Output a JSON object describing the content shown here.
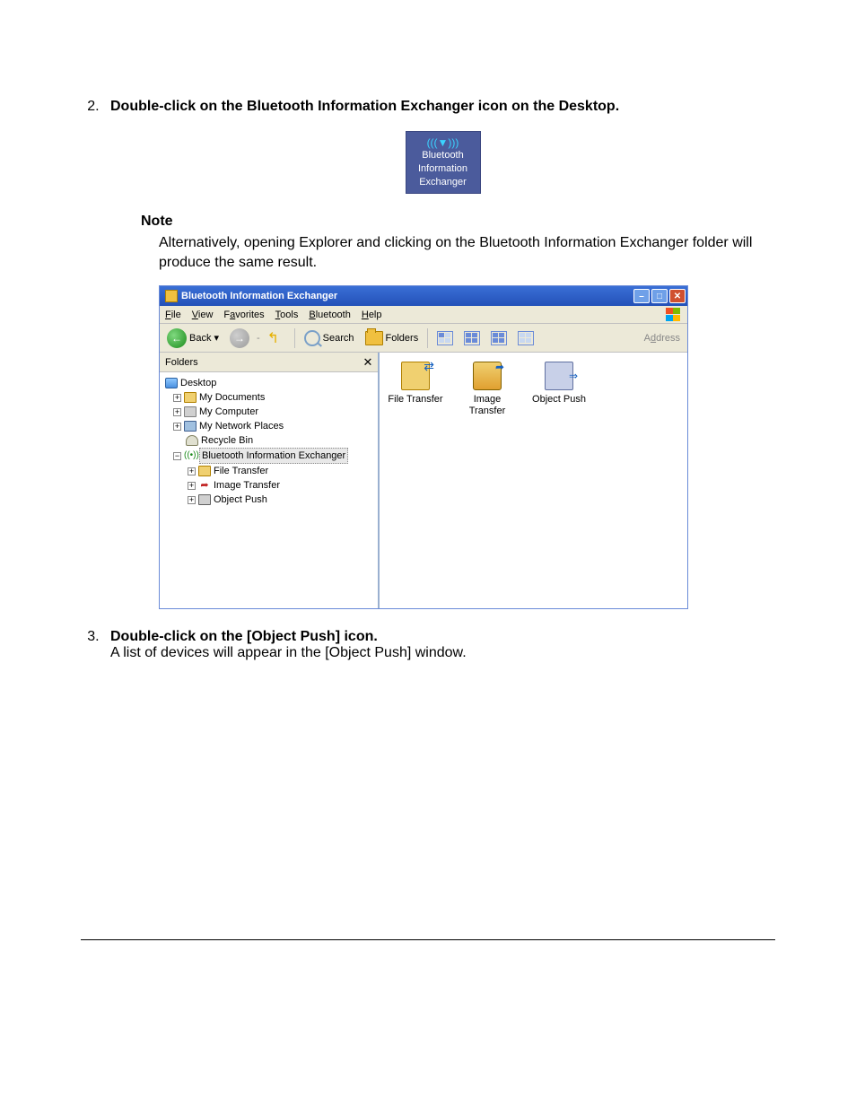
{
  "steps": {
    "s2": {
      "num": "2.",
      "head": "Double-click on the Bluetooth Information Exchanger icon on the Desktop."
    },
    "s3": {
      "num": "3.",
      "head": "Double-click on the [Object Push] icon.",
      "body": "A list of devices will appear in the [Object Push] window."
    }
  },
  "desktop_icon": {
    "l1": "Bluetooth",
    "l2": "Information",
    "l3": "Exchanger"
  },
  "note": {
    "head": "Note",
    "body": "Alternatively, opening Explorer and clicking on the Bluetooth Information Exchanger folder will produce the same result."
  },
  "win": {
    "title": "Bluetooth Information Exchanger",
    "menu": {
      "file": "File",
      "view": "View",
      "favorites": "Favorites",
      "tools": "Tools",
      "bluetooth": "Bluetooth",
      "help": "Help"
    },
    "toolbar": {
      "back": "Back",
      "search": "Search",
      "folders": "Folders",
      "address": "Address"
    },
    "tree": {
      "head": "Folders",
      "desktop": "Desktop",
      "mydocs": "My Documents",
      "mycomp": "My Computer",
      "mynet": "My Network Places",
      "bin": "Recycle Bin",
      "bie": "Bluetooth Information Exchanger",
      "ft": "File Transfer",
      "img": "Image Transfer",
      "op": "Object Push"
    },
    "pane": {
      "ft": "File Transfer",
      "img": "Image Transfer",
      "op": "Object Push"
    }
  }
}
